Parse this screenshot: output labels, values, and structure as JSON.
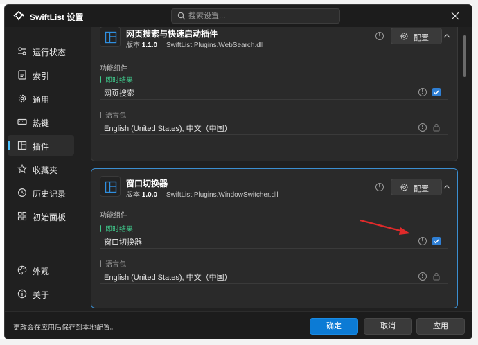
{
  "app": {
    "title": "SwiftList 设置"
  },
  "search": {
    "placeholder": "搜索设置..."
  },
  "sidebar": {
    "top_items": [
      {
        "label": "运行状态",
        "icon": "status-icon"
      },
      {
        "label": "索引",
        "icon": "index-icon"
      },
      {
        "label": "通用",
        "icon": "gear-icon"
      },
      {
        "label": "热键",
        "icon": "keyboard-icon"
      },
      {
        "label": "插件",
        "icon": "plugin-icon",
        "active": true
      },
      {
        "label": "收藏夹",
        "icon": "star-icon"
      },
      {
        "label": "历史记录",
        "icon": "history-icon"
      },
      {
        "label": "初始面板",
        "icon": "panel-icon"
      }
    ],
    "bottom_items": [
      {
        "label": "外观",
        "icon": "palette-icon"
      },
      {
        "label": "关于",
        "icon": "info-icon"
      }
    ]
  },
  "plugins": [
    {
      "name": "网页搜索与快速启动插件",
      "version_label": "版本",
      "version": "1.1.0",
      "dll": "SwiftList.Plugins.WebSearch.dll",
      "config_label": "配置",
      "components_label": "功能组件",
      "group_instant": "即时结果",
      "instant_item": "网页搜索",
      "group_lang": "语言包",
      "lang_item": "English (United States), 中文（中国）"
    },
    {
      "name": "窗口切换器",
      "version_label": "版本",
      "version": "1.0.0",
      "dll": "SwiftList.Plugins.WindowSwitcher.dll",
      "config_label": "配置",
      "components_label": "功能组件",
      "group_instant": "即时结果",
      "instant_item": "窗口切换器",
      "group_lang": "语言包",
      "lang_item": "English (United States), 中文（中国）"
    }
  ],
  "footer": {
    "note": "更改会在应用后保存到本地配置。",
    "ok": "确定",
    "cancel": "取消",
    "apply": "应用"
  },
  "colors": {
    "accent": "#0c7bd5",
    "indicator": "#4cc2ff",
    "instant_green": "#3fc68a",
    "annotation_arrow": "#e02a2a"
  }
}
